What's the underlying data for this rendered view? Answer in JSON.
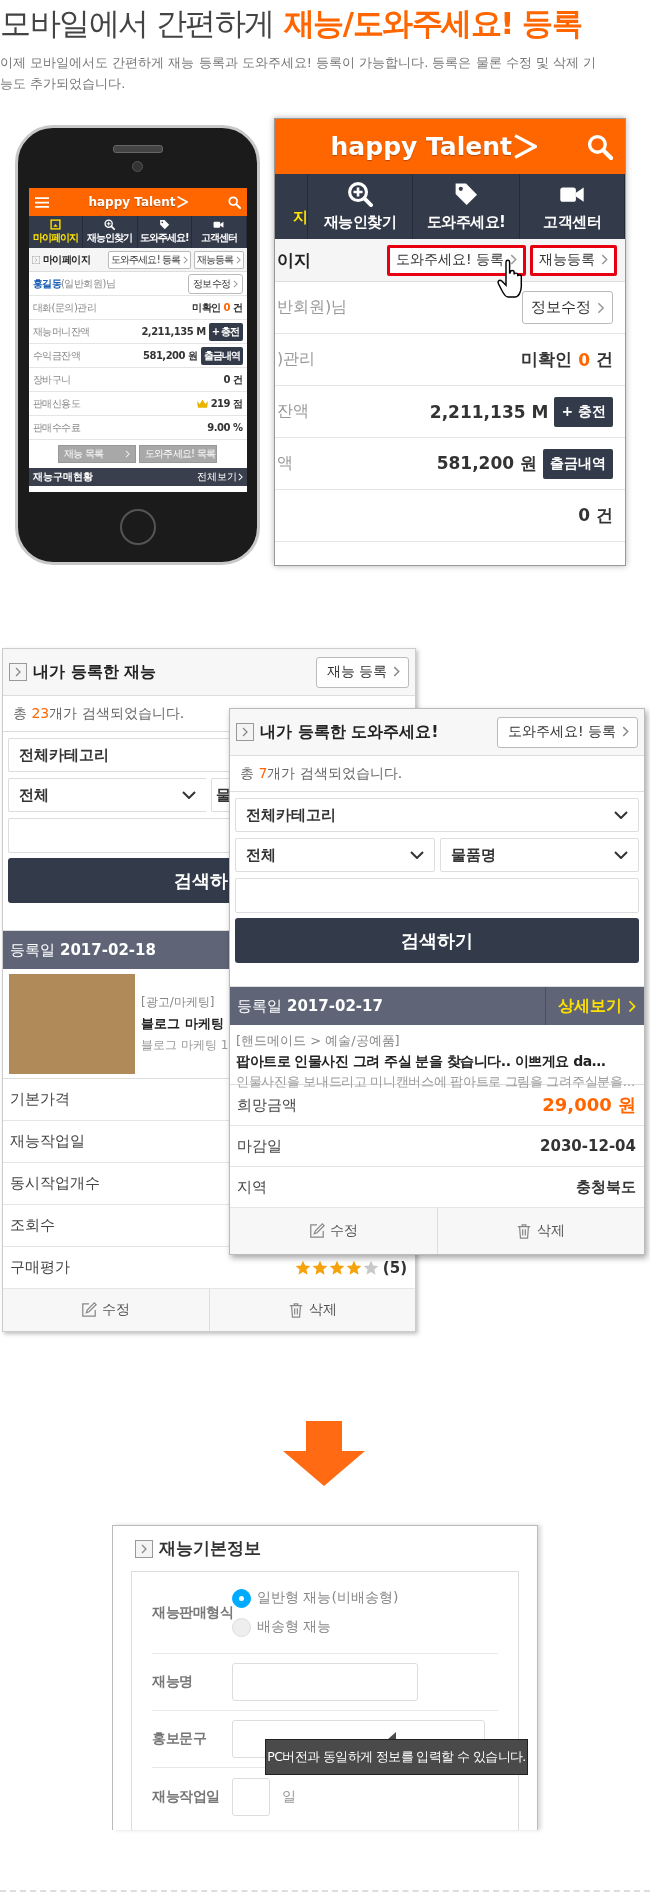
{
  "headline": {
    "text": "모바일에서 간편하게",
    "highlight": "재능/도와주세요! 등록"
  },
  "description": "이제 모바일에서도 간편하게 재능 등록과 도와주세요! 등록이 가능합니다. 등록은 물론 수정 및 삭제 기능도 추가되었습니다.",
  "phone": {
    "logo": "happy Talent",
    "nav": [
      {
        "label": "마이페이지",
        "selected": true
      },
      {
        "label": "재능인찾기",
        "selected": false
      },
      {
        "label": "도와주세요!",
        "selected": false
      },
      {
        "label": "고객센터",
        "selected": false
      }
    ],
    "page_title": "마이페이지",
    "header_buttons": [
      {
        "label": "도와주세요! 등록",
        "highlighted": false
      },
      {
        "label": "재능등록",
        "highlighted": false
      }
    ],
    "rows": [
      {
        "kind": "member",
        "name": "홍길동",
        "label": "(일반회원)님",
        "button": "정보수정"
      },
      {
        "kind": "count",
        "label": "대화(문의)관리",
        "value": "미확인",
        "highlight": "0",
        "unit": "건"
      },
      {
        "kind": "action",
        "label": "재능머니잔액",
        "value": "2,211,135 M",
        "button": "+ 충전"
      },
      {
        "kind": "action",
        "label": "수익금잔액",
        "value": "581,200 원",
        "button": "출금내역"
      },
      {
        "kind": "text",
        "label": "장바구니",
        "value": "0 건"
      },
      {
        "kind": "credit",
        "label": "판매신용도",
        "value": "219 점"
      },
      {
        "kind": "text",
        "label": "판매수수료",
        "value": "9.00 %"
      }
    ],
    "footer_buttons": [
      "재능 목록",
      "도와주세요! 목록"
    ],
    "bottom_bar": {
      "title": "재능구매현황",
      "link": "전체보기"
    }
  },
  "zoom_panel": {
    "logo": "happy Talent",
    "nav": [
      {
        "label": "지",
        "selected": true
      },
      {
        "label": "재능인찾기",
        "selected": false
      },
      {
        "label": "도와주세요!",
        "selected": false
      },
      {
        "label": "고객센터",
        "selected": false
      }
    ],
    "page_title": "이지",
    "header_buttons": [
      {
        "label": "도와주세요! 등록",
        "highlighted": true
      },
      {
        "label": "재능등록",
        "highlighted": true
      }
    ],
    "rows": [
      {
        "kind": "member",
        "label": "반회원)님",
        "button": "정보수정"
      },
      {
        "kind": "count",
        "label": ")관리",
        "value": "미확인",
        "highlight": "0",
        "unit": "건"
      },
      {
        "kind": "action",
        "label": "잔액",
        "value": "2,211,135 M",
        "button": "+ 충전"
      },
      {
        "kind": "action",
        "label": "액",
        "value": "581,200 원",
        "button": "출금내역"
      },
      {
        "kind": "text",
        "value": "0 건"
      }
    ]
  },
  "talent_card": {
    "title": "내가 등록한 재능",
    "button": "재능 등록",
    "count_prefix": "총",
    "count": "23",
    "count_suffix": "개가 검색되었습니다.",
    "category": "전체카테고리",
    "filter": "전체",
    "filter_2": "물",
    "search": "검색하",
    "date_label": "등록일",
    "date": "2017-02-18",
    "item": {
      "category": "[광고/마케팅]",
      "title": "블로그 마케팅",
      "subtitle": "블로그 마케팅 1"
    },
    "rows": [
      {
        "kind": "plain",
        "label": "기본가격"
      },
      {
        "kind": "plain",
        "label": "재능작업일"
      },
      {
        "kind": "plain",
        "label": "동시작업개수"
      },
      {
        "kind": "plain",
        "label": "조회수"
      },
      {
        "kind": "rating",
        "label": "구매평가",
        "stars": 4,
        "value": "(5)"
      }
    ],
    "actions": [
      "수정",
      "삭제"
    ]
  },
  "request_card": {
    "title": "내가 등록한 도와주세요!",
    "button": "도와주세요! 등록",
    "count_prefix": "총",
    "count": "7",
    "count_suffix": "개가 검색되었습니다.",
    "category": "전체카테고리",
    "filter": "전체",
    "filter_2": "물품명",
    "search": "검색하기",
    "date_label": "등록일",
    "date": "2017-02-17",
    "detail": "상세보기",
    "item": {
      "category": "[핸드메이드 > 예술/공예품]",
      "title": "팝아트로 인물사진 그려 주실 분을 찾습니다.. 이쁘게요 da…",
      "description": "인물사진을 보내드리고 미니캔버스에 팝아트로 그림을 그려주실분을…"
    },
    "rows": [
      {
        "kind": "price",
        "label": "희망금액",
        "value": "29,000 원"
      },
      {
        "kind": "text",
        "label": "마감일",
        "value": "2030-12-04"
      },
      {
        "kind": "text",
        "label": "지역",
        "value": "충청북도"
      }
    ],
    "actions": [
      "수정",
      "삭제"
    ]
  },
  "form": {
    "title": "재능기본정보",
    "fields": [
      {
        "kind": "radio",
        "label": "재능판매형식",
        "options": [
          {
            "label": "일반형 재능(비배송형)",
            "selected": true
          },
          {
            "label": "배송형 재능",
            "selected": false
          }
        ]
      },
      {
        "kind": "input",
        "label": "재능명"
      },
      {
        "kind": "input",
        "label": "홍보문구"
      },
      {
        "kind": "days",
        "label": "재능작업일",
        "unit": "일"
      }
    ],
    "tooltip": "PC버전과 동일하게 정보를 입력할 수 있습니다."
  }
}
